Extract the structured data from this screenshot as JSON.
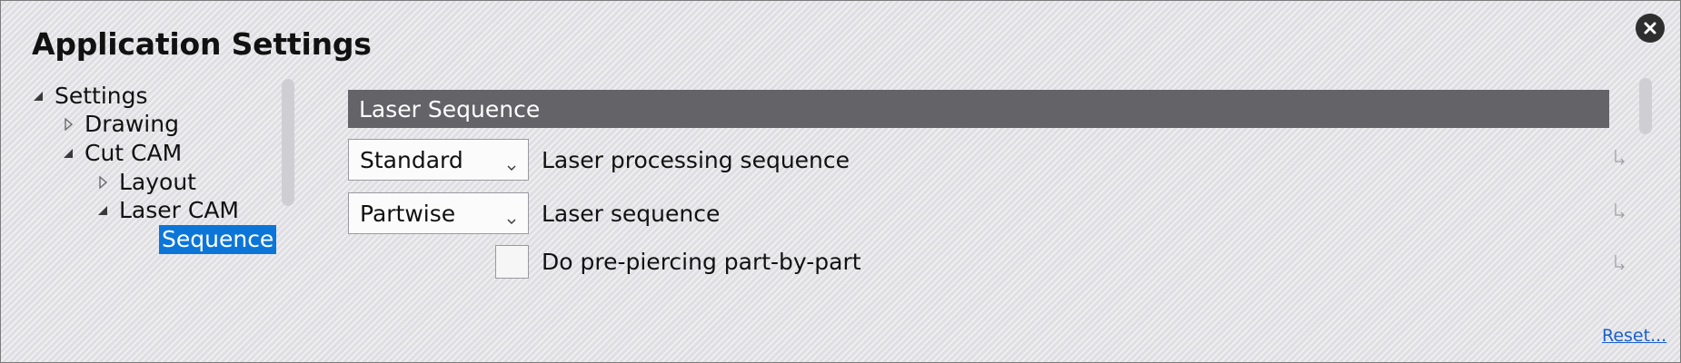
{
  "window": {
    "title": "Application Settings"
  },
  "tree": {
    "nodes": [
      {
        "label": "Settings",
        "state": "expanded"
      },
      {
        "label": "Drawing",
        "state": "collapsed"
      },
      {
        "label": "Cut CAM",
        "state": "expanded"
      },
      {
        "label": "Layout",
        "state": "collapsed"
      },
      {
        "label": "Laser CAM",
        "state": "expanded"
      },
      {
        "label": "Sequence",
        "state": "leaf",
        "selected": true
      }
    ]
  },
  "section": {
    "title": "Laser Sequence",
    "settings": [
      {
        "type": "dropdown",
        "value": "Standard",
        "label": "Laser processing sequence"
      },
      {
        "type": "dropdown",
        "value": "Partwise",
        "label": "Laser sequence"
      },
      {
        "type": "checkbox",
        "checked": false,
        "label": "Do pre-piercing part-by-part"
      }
    ]
  },
  "footer": {
    "reset_label": "Reset..."
  },
  "icons": {
    "close": "close-icon",
    "expanded": "triangle-expanded-icon",
    "collapsed": "triangle-collapsed-icon",
    "dropdown": "chevron-down-icon",
    "row_marker": "row-marker-icon"
  },
  "colors": {
    "selection": "#0b76d8",
    "section_header": "#636368",
    "link": "#1a5fc9"
  }
}
